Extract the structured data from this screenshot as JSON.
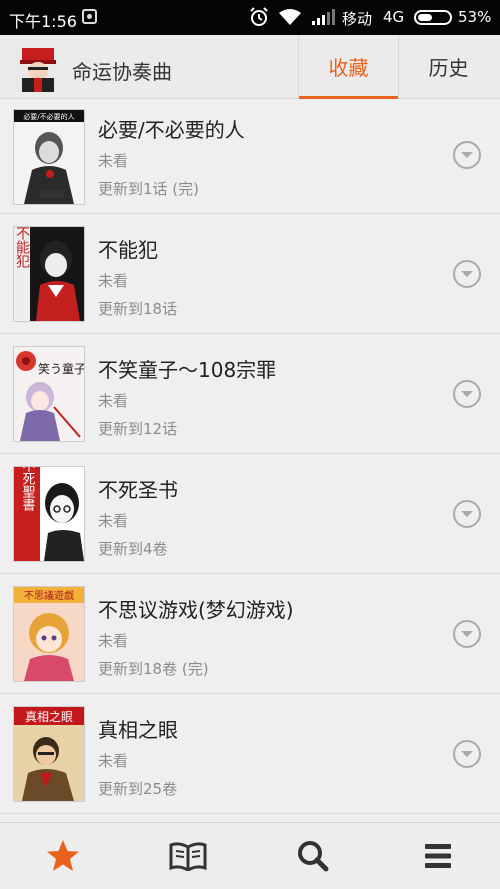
{
  "status_bar": {
    "time": "下午1:56",
    "carrier": "移动",
    "network": "4G",
    "battery": "53%",
    "battery_level": 0.53,
    "icons": [
      "notification-icon",
      "alarm-icon",
      "wifi-icon",
      "signal-icon",
      "battery-icon"
    ]
  },
  "header": {
    "title": "命运协奏曲",
    "tabs": [
      {
        "label": "收藏",
        "active": true
      },
      {
        "label": "历史",
        "active": false
      }
    ]
  },
  "list": {
    "items": [
      {
        "title": "必要/不必要的人",
        "status": "未看",
        "update": "更新到1话 (完)",
        "cover_text": "必要/不必要的人"
      },
      {
        "title": "不能犯",
        "status": "未看",
        "update": "更新到18话",
        "cover_text": "不能犯"
      },
      {
        "title": "不笑童子～108宗罪",
        "status": "未看",
        "update": "更新到12话",
        "cover_text": "笑う童子"
      },
      {
        "title": "不死圣书",
        "status": "未看",
        "update": "更新到4卷",
        "cover_text": "不死聖書"
      },
      {
        "title": "不思议游戏(梦幻游戏)",
        "status": "未看",
        "update": "更新到18卷 (完)",
        "cover_text": "不思議遊戯"
      },
      {
        "title": "真相之眼",
        "status": "未看",
        "update": "更新到25卷",
        "cover_text": "真相之眼"
      }
    ]
  },
  "bottom_nav": {
    "items": [
      {
        "icon": "star-icon",
        "active": true
      },
      {
        "icon": "book-icon",
        "active": false
      },
      {
        "icon": "search-icon",
        "active": false
      },
      {
        "icon": "menu-icon",
        "active": false
      }
    ]
  },
  "colors": {
    "accent": "#e8621e",
    "status_bar": "#050505",
    "secondary_text": "#8c8c8c"
  }
}
